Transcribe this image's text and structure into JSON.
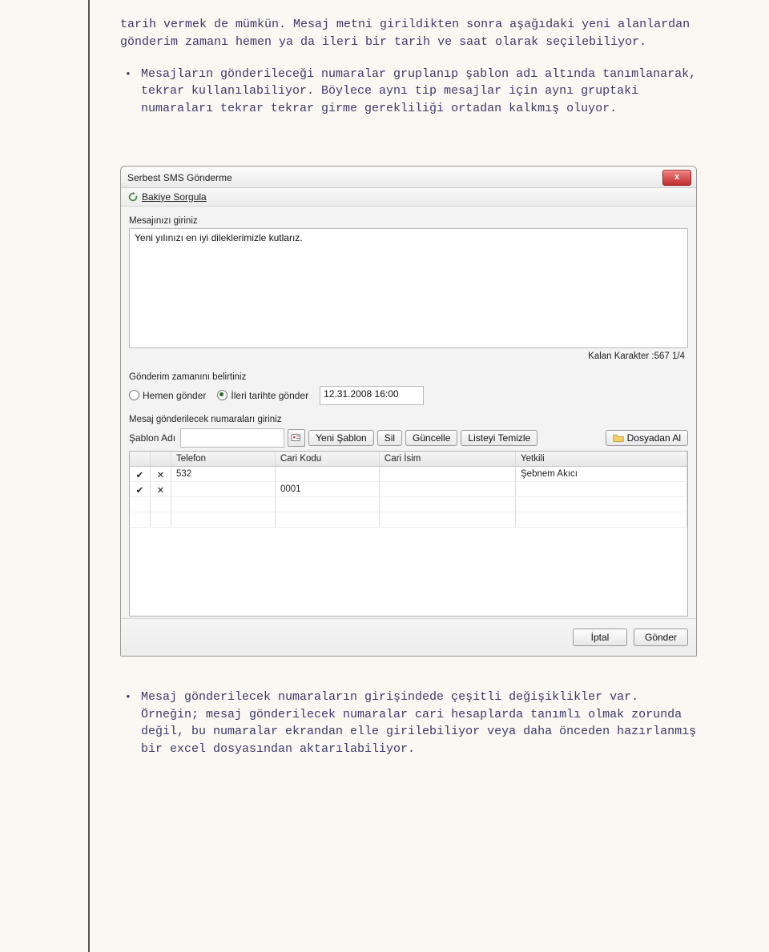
{
  "doc": {
    "p1": "tarih vermek de mümkün.  Mesaj metni girildikten sonra aşağıdaki yeni alanlardan gönderim zamanı hemen ya da ileri bir tarih ve saat olarak seçilebiliyor.",
    "p2": "Mesajların gönderileceği numaralar gruplanıp şablon adı altında tanımlanarak, tekrar kullanılabiliyor. Böylece aynı tip mesajlar için aynı gruptaki numaraları tekrar tekrar girme gerekliliği ortadan kalkmış oluyor.",
    "p3": "Mesaj gönderilecek numaraların girişindede çeşitli değişiklikler var. Örneğin; mesaj gönderilecek numaralar cari hesaplarda tanımlı olmak zorunda değil, bu numaralar ekrandan elle girilebiliyor veya daha önceden hazırlanmış bir excel dosyasından aktarılabiliyor."
  },
  "dialog": {
    "title": "Serbest SMS Gönderme",
    "closeLabel": "x",
    "bakiye": "Bakiye Sorgula",
    "msgLabel": "Mesajınızı giriniz",
    "msgValue": "Yeni yılınızı en iyi dileklerimizle kutlarız.",
    "counter": "Kalan Karakter :567    1/4",
    "timeLabel": "Gönderim zamanını belirtiniz",
    "radioNow": "Hemen gönder",
    "radioLater": "İleri tarihte gönder",
    "dateValue": "12.31.2008 16:00",
    "numLabel": "Mesaj gönderilecek numaraları giriniz",
    "sablonLabel": "Şablon Adı",
    "btnYeni": "Yeni Şablon",
    "btnSil": "Sil",
    "btnGuncelle": "Güncelle",
    "btnListeyiTemizle": "Listeyi Temizle",
    "btnDosyadan": "Dosyadan Al",
    "th": {
      "telefon": "Telefon",
      "cariKodu": "Cari Kodu",
      "cariIsim": "Cari İsim",
      "yetkili": "Yetkili"
    },
    "rows": [
      {
        "check": "✔",
        "del": "✕",
        "telefon": "532",
        "cariKodu": "",
        "cariIsim": "",
        "yetkili": "Şebnem Akıcı"
      },
      {
        "check": "✔",
        "del": "✕",
        "telefon": "",
        "cariKodu": "0001",
        "cariIsim": "",
        "yetkili": ""
      }
    ],
    "btnIptal": "İptal",
    "btnGonder": "Gönder"
  }
}
